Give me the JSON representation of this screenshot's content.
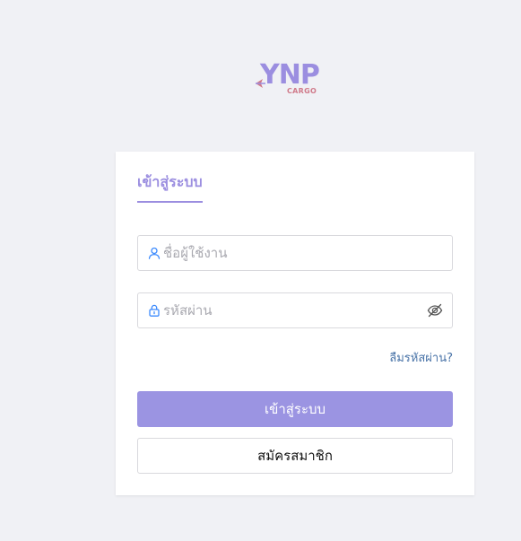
{
  "brand": {
    "logo_main": "YNP",
    "logo_sub": "CARGO",
    "logo_color": "#9b8ee0",
    "logo_sub_color": "#d07a8a"
  },
  "login": {
    "tab_label": "เข้าสู่ระบบ",
    "username": {
      "value": "",
      "placeholder": "ชื่อผู้ใช้งาน",
      "icon": "user-icon"
    },
    "password": {
      "value": "",
      "placeholder": "รหัสผ่าน",
      "icon": "lock-icon",
      "toggle_icon": "eye-off-icon"
    },
    "forgot_label": "ลืมรหัสผ่าน?",
    "submit_label": "เข้าสู่ระบบ",
    "register_label": "สมัครสมาชิก"
  },
  "colors": {
    "accent": "#9b8ee0",
    "primary_button": "#9b94e2",
    "link": "#4a74a8",
    "input_icon": "#3d8bfd",
    "background": "#f0f1f5"
  }
}
